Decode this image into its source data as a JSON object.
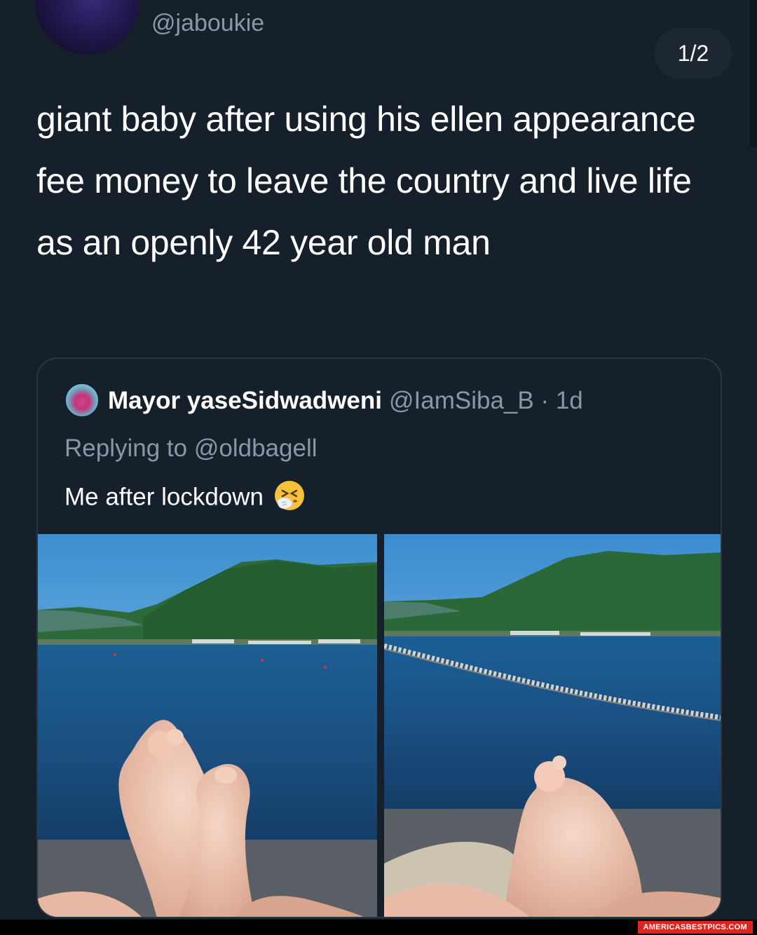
{
  "tweet": {
    "handle": "@jaboukie",
    "page_counter": "1/2",
    "text": "giant baby after using his ellen appearance fee money to leave the country and live life as an openly 42 year old man"
  },
  "quoted": {
    "name": "Mayor yaseSidwadweni",
    "meta": "@IamSiba_B · 1d",
    "reply_prefix": "Replying to",
    "reply_handle": "@oldbagell",
    "text": "Me after lockdown",
    "emoji_icon": "sneezing-face-icon"
  },
  "watermark": "AMERICASBESTPICS.COM",
  "colors": {
    "background": "#15202b",
    "muted_text": "#8899a6",
    "text": "#ffffff",
    "card_border": "#2a3640"
  }
}
